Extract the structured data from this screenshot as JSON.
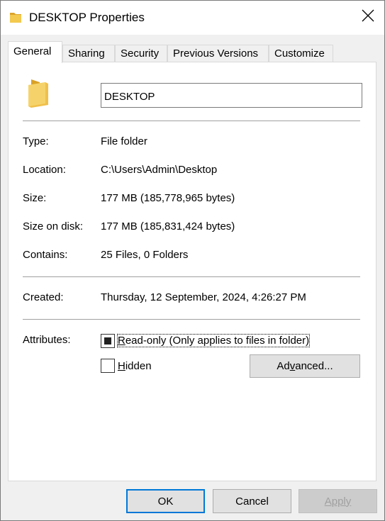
{
  "window": {
    "title": "DESKTOP Properties"
  },
  "icons": {
    "title": "folder-icon",
    "large": "folder-icon",
    "close": "close-icon"
  },
  "colors": {
    "folder": "#e8b33a",
    "accent": "#0078d7"
  },
  "tabs": [
    {
      "label": "General",
      "active": true
    },
    {
      "label": "Sharing",
      "active": false
    },
    {
      "label": "Security",
      "active": false
    },
    {
      "label": "Previous Versions",
      "active": false
    },
    {
      "label": "Customize",
      "active": false
    }
  ],
  "general": {
    "folder_name": "DESKTOP",
    "type": {
      "label": "Type:",
      "value": "File folder"
    },
    "location": {
      "label": "Location:",
      "value": "C:\\Users\\Admin\\Desktop"
    },
    "size": {
      "label": "Size:",
      "value": "177 MB (185,778,965 bytes)"
    },
    "size_on_disk": {
      "label": "Size on disk:",
      "value": "177 MB (185,831,424 bytes)"
    },
    "contains": {
      "label": "Contains:",
      "value": "25 Files, 0 Folders"
    },
    "created": {
      "label": "Created:",
      "value": "Thursday, 12 September, 2024, 4:26:27 PM"
    },
    "attributes": {
      "label": "Attributes:",
      "readonly": {
        "label_first": "R",
        "label_rest": "ead-only (Only applies to files in folder)",
        "state": "indeterminate"
      },
      "hidden": {
        "label_first": "H",
        "label_rest": "idden",
        "checked": false
      },
      "advanced": {
        "label_pre": "Ad",
        "label_ul": "v",
        "label_post": "anced..."
      }
    }
  },
  "footer": {
    "ok": "OK",
    "cancel": "Cancel",
    "apply": "Apply"
  }
}
